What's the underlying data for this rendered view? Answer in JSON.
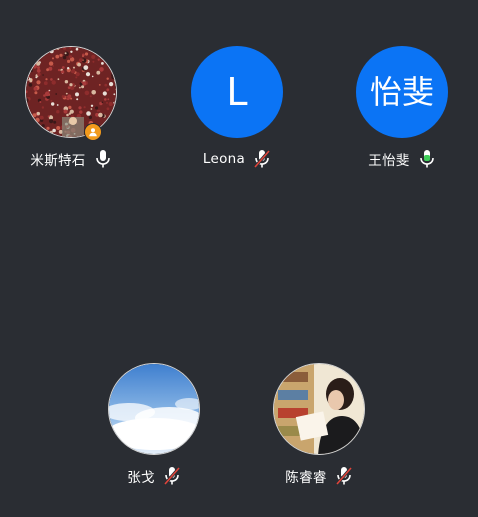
{
  "participants": [
    {
      "name": "米斯特石",
      "avatar_type": "photo",
      "photo_theme": "crowd",
      "mic": "on",
      "mic_color": "#ffffff",
      "host": true
    },
    {
      "name": "Leona",
      "avatar_type": "letter",
      "avatar_text": "L",
      "avatar_bg": "#0b74f5",
      "mic": "muted",
      "host": false
    },
    {
      "name": "王怡斐",
      "avatar_type": "letter",
      "avatar_text": "怡斐",
      "avatar_bg": "#0b74f5",
      "mic": "on",
      "mic_color": "#3fce5a",
      "host": false
    },
    {
      "name": "张戈",
      "avatar_type": "photo",
      "photo_theme": "sky",
      "mic": "muted",
      "host": false
    },
    {
      "name": "陈睿睿",
      "avatar_type": "photo",
      "photo_theme": "reader",
      "mic": "muted",
      "host": false
    }
  ],
  "icons": {
    "mic": "microphone-icon",
    "mic_muted": "microphone-muted-icon",
    "host": "host-user-icon"
  },
  "colors": {
    "background": "#2a2d33",
    "avatar_blue": "#0b74f5",
    "mic_active_green": "#3fce5a",
    "mute_slash_red": "#e0443a",
    "host_badge": "#f29a1c"
  }
}
